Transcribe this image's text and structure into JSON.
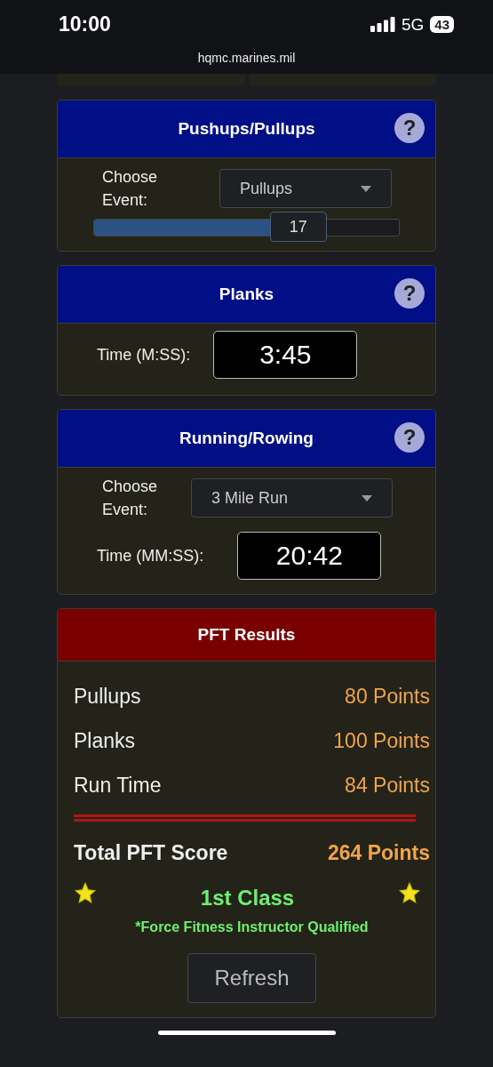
{
  "status_bar": {
    "time": "10:00",
    "network": "5G",
    "battery": "43"
  },
  "address_bar": {
    "url": "hqmc.marines.mil"
  },
  "cards": [
    {
      "kind": "select_slider",
      "title": "Pushups/Pullups",
      "help": "?",
      "select_label": "Choose Event:",
      "select_value": "Pullups",
      "slider": {
        "level": 0.67,
        "value": "17"
      }
    },
    {
      "kind": "time",
      "title": "Planks",
      "help": "?",
      "time_label": "Time (M:SS):",
      "time_value": "3:45"
    },
    {
      "kind": "select_time",
      "title": "Running/Rowing",
      "help": "?",
      "select_label": "Choose Event:",
      "select_value": "3 Mile Run",
      "time_label": "Time (MM:SS):",
      "time_value": "20:42"
    }
  ],
  "results": {
    "title": "PFT Results",
    "rows": [
      {
        "label": "Pullups",
        "points": "80 Points"
      },
      {
        "label": "Planks",
        "points": "100 Points"
      },
      {
        "label": "Run Time",
        "points": "84 Points"
      }
    ],
    "total": {
      "label": "Total PFT Score",
      "points": "264 Points"
    },
    "class": "1st Class",
    "qualification": "*Force Fitness Instructor Qualified",
    "button": "Refresh"
  }
}
